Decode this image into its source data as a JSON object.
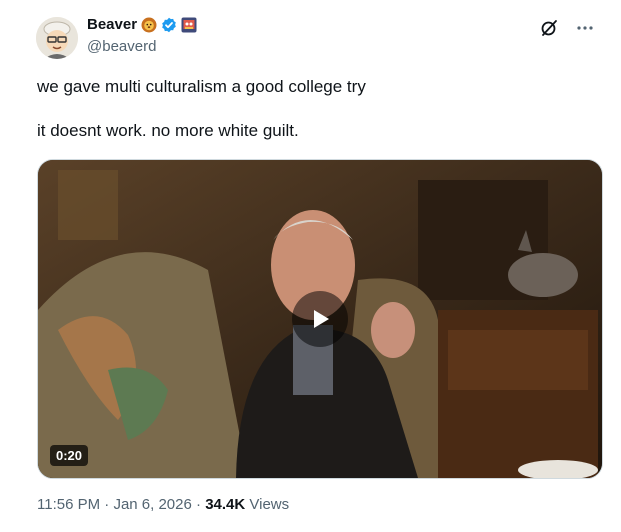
{
  "author": {
    "name": "Beaver",
    "handle": "@beaverd",
    "badges": [
      "lion-emoji",
      "verified-check-icon",
      "community-badge-icon"
    ]
  },
  "tweet": {
    "line1": "we gave multi culturalism a good college try",
    "line2": "it doesnt work. no more white guilt."
  },
  "video": {
    "duration": "0:20"
  },
  "meta": {
    "time": "11:56 PM",
    "separator": "·",
    "date": "Jan 6, 2026",
    "views_count": "34.4K",
    "views_label": "Views"
  },
  "colors": {
    "verified": "#1d9bf0",
    "secondary_text": "#536471",
    "primary_text": "#0f1419"
  }
}
